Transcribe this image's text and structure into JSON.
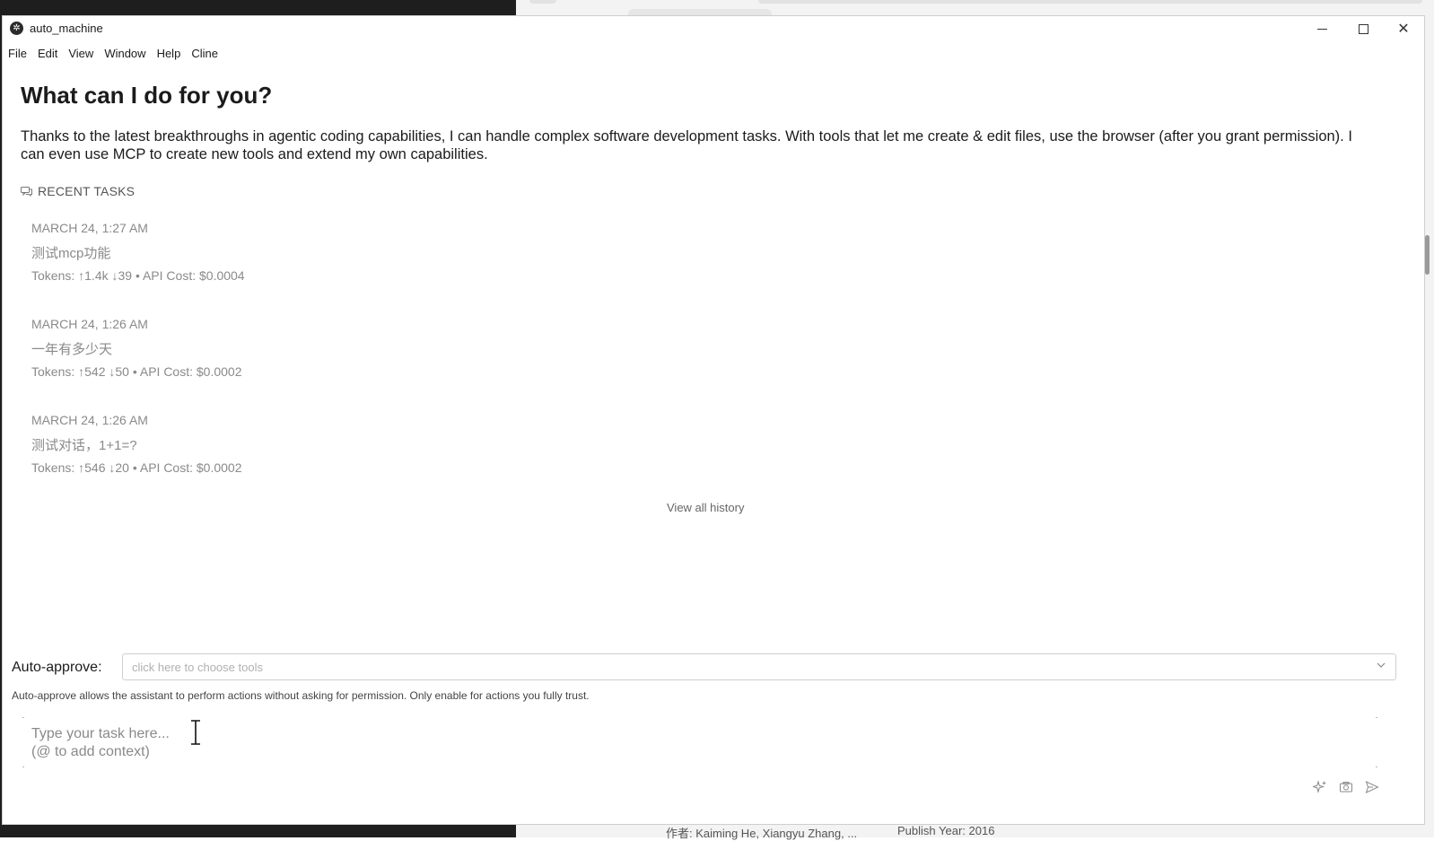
{
  "window": {
    "title": "auto_machine"
  },
  "menu": [
    "File",
    "Edit",
    "View",
    "Window",
    "Help",
    "Cline"
  ],
  "main": {
    "heading": "What can I do for you?",
    "intro": "Thanks to the latest breakthroughs in agentic coding capabilities, I can handle complex software development tasks. With tools that let me create & edit files, use the browser (after you grant permission). I can even use MCP to create new tools and extend my own capabilities.",
    "recent_label": "RECENT TASKS",
    "tasks": [
      {
        "date": "MARCH 24, 1:27 AM",
        "title": "测试mcp功能",
        "meta": "Tokens: ↑1.4k ↓39 • API Cost: $0.0004"
      },
      {
        "date": "MARCH 24, 1:26 AM",
        "title": "一年有多少天",
        "meta": "Tokens: ↑542 ↓50 • API Cost: $0.0002"
      },
      {
        "date": "MARCH 24, 1:26 AM",
        "title": "测试对话，1+1=?",
        "meta": "Tokens: ↑546 ↓20 • API Cost: $0.0002"
      }
    ],
    "view_all": "View all history"
  },
  "auto_approve": {
    "label": "Auto-approve:",
    "placeholder": "click here to choose tools",
    "note": "Auto-approve allows the assistant to perform actions without asking for permission. Only enable for actions you fully trust."
  },
  "input": {
    "placeholder": "Type your task here...\n(@ to add context)"
  },
  "icons": {
    "enhance": "sparkle-icon",
    "image": "camera-icon",
    "send": "send-icon"
  },
  "background": {
    "bottom_text_1": "作者: Kaiming He, Xiangyu Zhang, ...",
    "bottom_text_2": "Publish Year: 2016"
  }
}
